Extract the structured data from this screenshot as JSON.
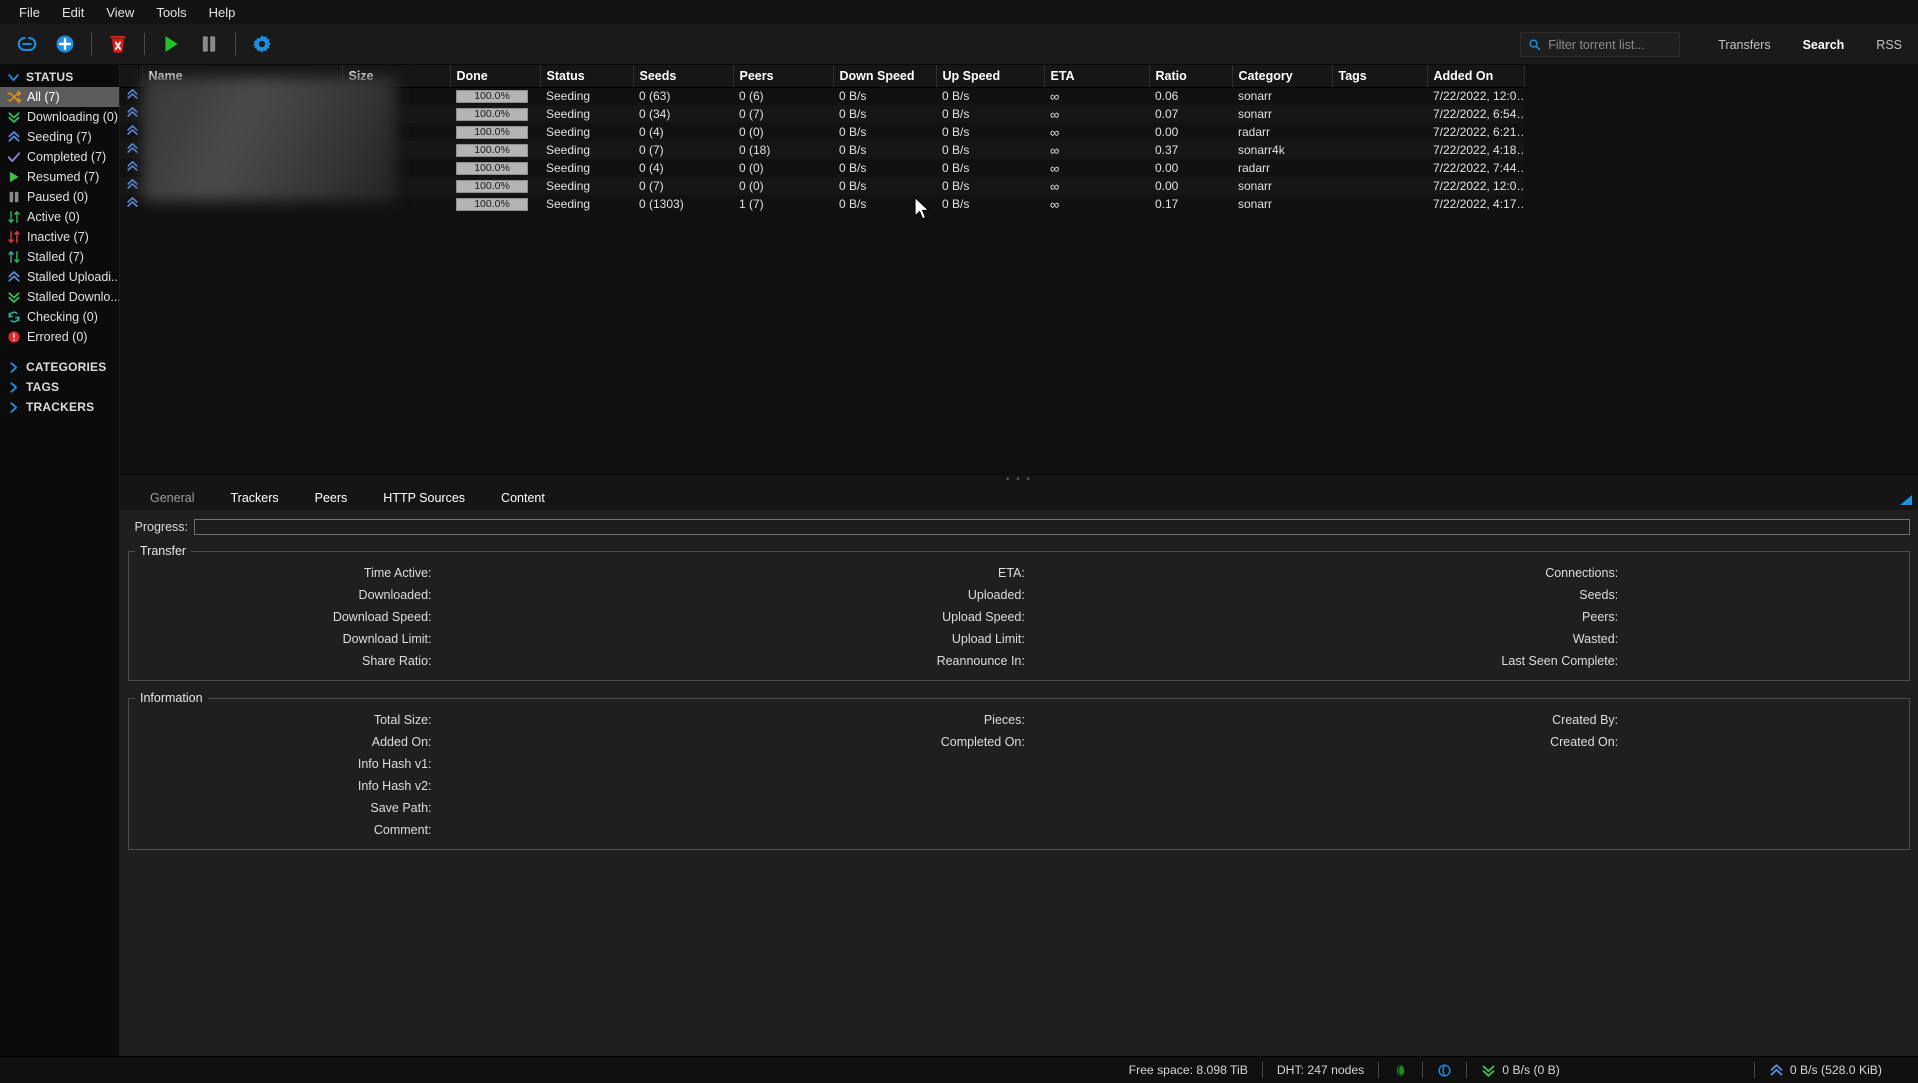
{
  "window": {
    "title": "qBittorrent"
  },
  "menubar": {
    "items": [
      "File",
      "Edit",
      "View",
      "Tools",
      "Help"
    ]
  },
  "toolbar": {
    "buttons": [
      {
        "name": "add-torrent-link-button",
        "icon": "link-icon",
        "title": "Add torrent link"
      },
      {
        "name": "add-torrent-file-button",
        "icon": "plus-circle-icon",
        "title": "Add torrent file"
      },
      {
        "name": "delete-button",
        "icon": "trash-x-icon",
        "title": "Remove"
      },
      {
        "name": "resume-button",
        "icon": "play-icon",
        "title": "Resume"
      },
      {
        "name": "pause-button",
        "icon": "pause-icon",
        "title": "Pause"
      },
      {
        "name": "preferences-button",
        "icon": "gear-icon",
        "title": "Options"
      }
    ]
  },
  "search": {
    "placeholder": "Filter torrent list...",
    "value": "",
    "icon": "search-icon"
  },
  "topnav": {
    "items": [
      {
        "label": "Transfers",
        "active": false
      },
      {
        "label": "Search",
        "active": true
      },
      {
        "label": "RSS",
        "active": false
      }
    ]
  },
  "sidebar": {
    "groups": [
      {
        "name": "status",
        "label": "STATUS",
        "expanded": true,
        "icon": "chevron-down-icon"
      },
      {
        "name": "categories",
        "label": "CATEGORIES",
        "expanded": false,
        "icon": "chevron-right-icon"
      },
      {
        "name": "tags",
        "label": "TAGS",
        "expanded": false,
        "icon": "chevron-right-icon"
      },
      {
        "name": "trackers",
        "label": "TRACKERS",
        "expanded": false,
        "icon": "chevron-right-icon"
      }
    ],
    "status_items": [
      {
        "label": "All (7)",
        "icon": "shuffle-icon",
        "color": "#e8920d",
        "selected": true
      },
      {
        "label": "Downloading (0)",
        "icon": "double-chevron-down",
        "color": "#3fbf5f",
        "selected": false
      },
      {
        "label": "Seeding (7)",
        "icon": "double-chevron-up",
        "color": "#5b8fe0",
        "selected": false
      },
      {
        "label": "Completed (7)",
        "icon": "check-icon",
        "color": "#8d7fd6",
        "selected": false
      },
      {
        "label": "Resumed (7)",
        "icon": "play-icon",
        "color": "#3fbf3f",
        "selected": false
      },
      {
        "label": "Paused (0)",
        "icon": "pause-icon",
        "color": "#888888",
        "selected": false
      },
      {
        "label": "Active (0)",
        "icon": "arrows-down-up-green",
        "color": "#2faf4f",
        "selected": false
      },
      {
        "label": "Inactive (7)",
        "icon": "arrows-down-up-red",
        "color": "#d43b3b",
        "selected": false
      },
      {
        "label": "Stalled (7)",
        "icon": "arrows-up-down-teal",
        "color": "#3fa0a0",
        "selected": false
      },
      {
        "label": "Stalled Uploadi...",
        "icon": "double-chevron-up",
        "color": "#5b8fe0",
        "selected": false
      },
      {
        "label": "Stalled Downlo...",
        "icon": "double-chevron-down",
        "color": "#3fbf5f",
        "selected": false
      },
      {
        "label": "Checking (0)",
        "icon": "refresh-icon",
        "color": "#37b0a0",
        "selected": false
      },
      {
        "label": "Errored (0)",
        "icon": "error-icon",
        "color": "#e02b2b",
        "selected": false
      }
    ]
  },
  "torrent_table": {
    "columns": [
      "Name",
      "Size",
      "Done",
      "Status",
      "Seeds",
      "Peers",
      "Down Speed",
      "Up Speed",
      "ETA",
      "Ratio",
      "Category",
      "Tags",
      "Added On"
    ],
    "rows": [
      {
        "icon": "double-chevron-up",
        "name": "",
        "size": "",
        "done": "100.0%",
        "status": "Seeding",
        "seeds": "0 (63)",
        "peers": "0 (6)",
        "down": "0 B/s",
        "up": "0 B/s",
        "eta": "∞",
        "ratio": "0.06",
        "category": "sonarr",
        "tags": "",
        "added": "7/22/2022, 12:0…"
      },
      {
        "icon": "double-chevron-up",
        "name": "",
        "size": "",
        "done": "100.0%",
        "status": "Seeding",
        "seeds": "0 (34)",
        "peers": "0 (7)",
        "down": "0 B/s",
        "up": "0 B/s",
        "eta": "∞",
        "ratio": "0.07",
        "category": "sonarr",
        "tags": "",
        "added": "7/22/2022, 6:54…"
      },
      {
        "icon": "double-chevron-up",
        "name": "",
        "size": "",
        "done": "100.0%",
        "status": "Seeding",
        "seeds": "0 (4)",
        "peers": "0 (0)",
        "down": "0 B/s",
        "up": "0 B/s",
        "eta": "∞",
        "ratio": "0.00",
        "category": "radarr",
        "tags": "",
        "added": "7/22/2022, 6:21…"
      },
      {
        "icon": "double-chevron-up",
        "name": "",
        "size": "",
        "done": "100.0%",
        "status": "Seeding",
        "seeds": "0 (7)",
        "peers": "0 (18)",
        "down": "0 B/s",
        "up": "0 B/s",
        "eta": "∞",
        "ratio": "0.37",
        "category": "sonarr4k",
        "tags": "",
        "added": "7/22/2022, 4:18…"
      },
      {
        "icon": "double-chevron-up",
        "name": "",
        "size": "",
        "done": "100.0%",
        "status": "Seeding",
        "seeds": "0 (4)",
        "peers": "0 (0)",
        "down": "0 B/s",
        "up": "0 B/s",
        "eta": "∞",
        "ratio": "0.00",
        "category": "radarr",
        "tags": "",
        "added": "7/22/2022, 7:44…"
      },
      {
        "icon": "double-chevron-up",
        "name": "",
        "size": "",
        "done": "100.0%",
        "status": "Seeding",
        "seeds": "0 (7)",
        "peers": "0 (0)",
        "down": "0 B/s",
        "up": "0 B/s",
        "eta": "∞",
        "ratio": "0.00",
        "category": "sonarr",
        "tags": "",
        "added": "7/22/2022, 12:0…"
      },
      {
        "icon": "double-chevron-up",
        "name": "",
        "size": "",
        "done": "100.0%",
        "status": "Seeding",
        "seeds": "0 (1303)",
        "peers": "1 (7)",
        "down": "0 B/s",
        "up": "0 B/s",
        "eta": "∞",
        "ratio": "0.17",
        "category": "sonarr",
        "tags": "",
        "added": "7/22/2022, 4:17…"
      }
    ]
  },
  "details": {
    "tabs": [
      {
        "label": "General",
        "active": true
      },
      {
        "label": "Trackers",
        "active": false
      },
      {
        "label": "Peers",
        "active": false
      },
      {
        "label": "HTTP Sources",
        "active": false
      },
      {
        "label": "Content",
        "active": false
      }
    ],
    "progress_label": "Progress:",
    "progress_value": "",
    "transfer": {
      "legend": "Transfer",
      "col1": [
        {
          "key": "Time Active:",
          "value": ""
        },
        {
          "key": "Downloaded:",
          "value": ""
        },
        {
          "key": "Download Speed:",
          "value": ""
        },
        {
          "key": "Download Limit:",
          "value": ""
        },
        {
          "key": "Share Ratio:",
          "value": ""
        }
      ],
      "col2": [
        {
          "key": "ETA:",
          "value": ""
        },
        {
          "key": "Uploaded:",
          "value": ""
        },
        {
          "key": "Upload Speed:",
          "value": ""
        },
        {
          "key": "Upload Limit:",
          "value": ""
        },
        {
          "key": "Reannounce In:",
          "value": ""
        }
      ],
      "col3": [
        {
          "key": "Connections:",
          "value": ""
        },
        {
          "key": "Seeds:",
          "value": ""
        },
        {
          "key": "Peers:",
          "value": ""
        },
        {
          "key": "Wasted:",
          "value": ""
        },
        {
          "key": "Last Seen Complete:",
          "value": ""
        }
      ]
    },
    "information": {
      "legend": "Information",
      "col1": [
        {
          "key": "Total Size:",
          "value": ""
        },
        {
          "key": "Added On:",
          "value": ""
        },
        {
          "key": "Info Hash v1:",
          "value": ""
        },
        {
          "key": "Info Hash v2:",
          "value": ""
        },
        {
          "key": "Save Path:",
          "value": ""
        },
        {
          "key": "Comment:",
          "value": ""
        }
      ],
      "col2": [
        {
          "key": "Pieces:",
          "value": ""
        },
        {
          "key": "Completed On:",
          "value": ""
        }
      ],
      "col3": [
        {
          "key": "Created By:",
          "value": ""
        },
        {
          "key": "Created On:",
          "value": ""
        }
      ]
    }
  },
  "statusbar": {
    "free_space": "Free space: 8.098 TiB",
    "dht": "DHT: 247 nodes",
    "connection_icon": "connection-status-icon",
    "altspeed_icon": "alt-speed-icon",
    "download_rate": "0 B/s (0 B)",
    "upload_rate": "0 B/s (528.0 KiB)"
  },
  "colors": {
    "accent_blue": "#1e8fe0",
    "green": "#22c322",
    "red": "#e02b2b",
    "selected_row": "#5c5c5c"
  }
}
